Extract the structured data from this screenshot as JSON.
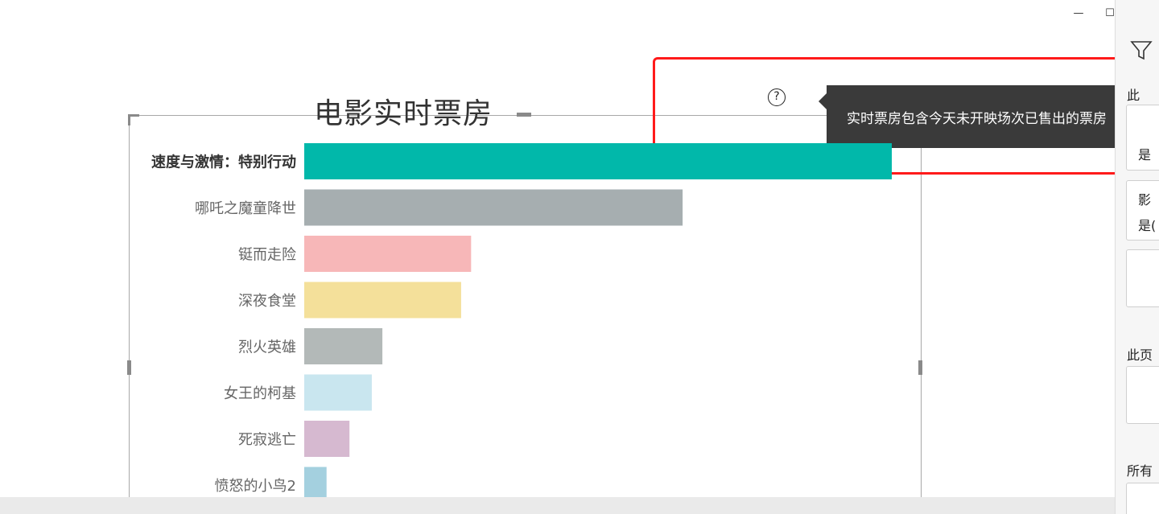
{
  "window": {
    "minimize_glyph": "—",
    "maximize_glyph": "☐",
    "close_glyph": "✕"
  },
  "visual": {
    "title": "电影实时票房",
    "help_glyph": "?",
    "tooltip_text": "实时票房包含今天未开映场次已售出的票房"
  },
  "right_panel": {
    "filter_icon": "filter-icon",
    "items": [
      "此",
      "是",
      "影",
      "是(",
      "此页",
      "所有"
    ]
  },
  "chart_data": {
    "type": "bar",
    "orientation": "horizontal",
    "title": "电影实时票房",
    "categories": [
      "速度与激情：特别行动",
      "哪吒之魔童降世",
      "铤而走险",
      "深夜食堂",
      "烈火英雄",
      "女王的柯基",
      "死寂逃亡",
      "愤怒的小鸟2"
    ],
    "values": [
      100,
      64.4,
      28.4,
      26.7,
      13.3,
      11.5,
      7.7,
      3.8
    ],
    "colors": [
      "#01b8aa",
      "#a6aeb0",
      "#f7b7b8",
      "#f4e09a",
      "#b3b9b8",
      "#c9e6ef",
      "#d6b9d0",
      "#a4d0df"
    ],
    "highlighted_category": "速度与激情：特别行动",
    "xlim": [
      0,
      100
    ],
    "grid": false,
    "legend": "none"
  }
}
